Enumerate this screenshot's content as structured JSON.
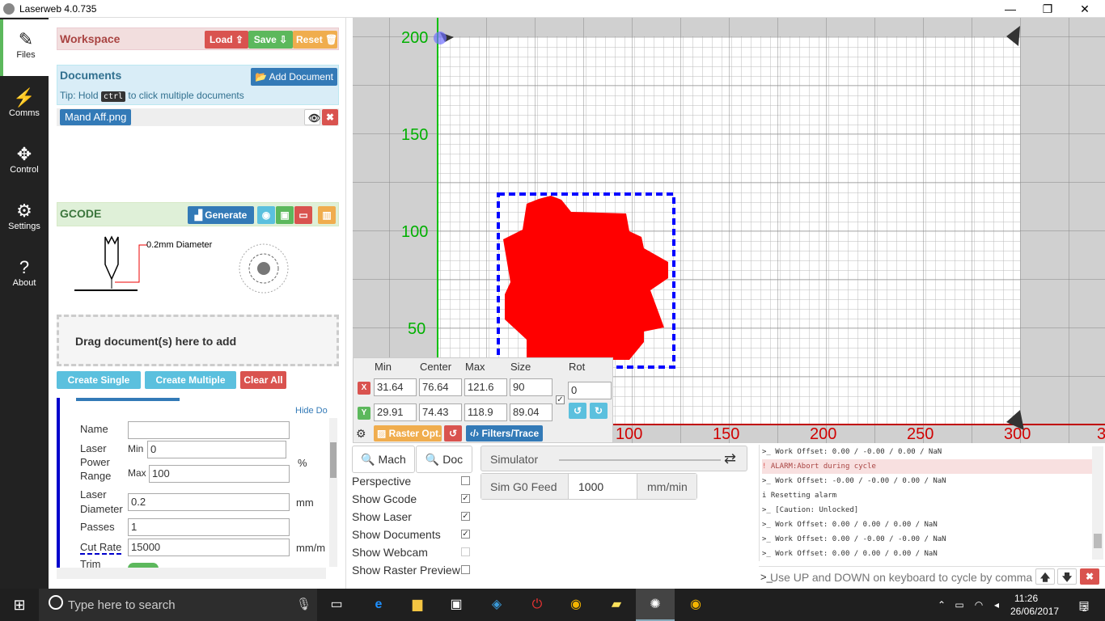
{
  "window": {
    "title": "Laserweb 4.0.735",
    "min": "—",
    "max": "❐",
    "close": "✕"
  },
  "nav": [
    {
      "label": "Files",
      "icon": "✎"
    },
    {
      "label": "Comms",
      "icon": "⚡"
    },
    {
      "label": "Control",
      "icon": "✥"
    },
    {
      "label": "Settings",
      "icon": "⚙"
    },
    {
      "label": "About",
      "icon": "?"
    }
  ],
  "workspace": {
    "title": "Workspace",
    "load": "Load ⇪",
    "save": "Save ⇩",
    "reset": "Reset 🗑"
  },
  "documents": {
    "title": "Documents",
    "add": "Add Document",
    "tip_pre": "Tip: Hold",
    "tip_key": "ctrl",
    "tip_post": "to click multiple documents",
    "file": "Mand Aff.png"
  },
  "gcode": {
    "title": "GCODE",
    "generate": "Generate",
    "diameter_label": "0.2mm Diameter"
  },
  "drop": {
    "text": "Drag document(s) here to add"
  },
  "ops": {
    "create_single": "Create Single",
    "create_multiple": "Create Multiple",
    "clear_all": "Clear All",
    "hide_docs": "Hide Do"
  },
  "form": {
    "name_label": "Name",
    "name_value": "",
    "power_label_1": "Laser",
    "power_label_2": "Power",
    "power_label_3": "Range",
    "min_label": "Min",
    "min_value": "0",
    "max_label": "Max",
    "max_value": "100",
    "percent": "%",
    "diam_label_1": "Laser",
    "diam_label_2": "Diameter",
    "diam_value": "0.2",
    "mm": "mm",
    "passes_label": "Passes",
    "passes_value": "1",
    "cutrate_label": "Cut Rate",
    "cutrate_value": "15000",
    "mmm": "mm/m",
    "trim_label": "Trim"
  },
  "axes": {
    "y_ticks": [
      "200",
      "150",
      "100",
      "50"
    ],
    "x_ticks": [
      "100",
      "150",
      "200",
      "250",
      "300",
      "3"
    ]
  },
  "transform": {
    "headers": [
      "Min",
      "Center",
      "Max",
      "Size",
      "Rot"
    ],
    "x_label": "X",
    "y_label": "Y",
    "x": {
      "min": "31.64",
      "center": "76.64",
      "max": "121.6",
      "size": "90"
    },
    "y": {
      "min": "29.91",
      "center": "74.43",
      "max": "118.9",
      "size": "89.04"
    },
    "rot": "0",
    "raster_opt": "Raster Opt.",
    "filters": "Filters/Trace"
  },
  "view": {
    "mach": "Mach",
    "doc": "Doc",
    "options": [
      {
        "label": "Perspective",
        "checked": false
      },
      {
        "label": "Show Gcode",
        "checked": true
      },
      {
        "label": "Show Laser",
        "checked": true
      },
      {
        "label": "Show Documents",
        "checked": true
      },
      {
        "label": "Show Webcam",
        "checked": false
      },
      {
        "label": "Show Raster Preview",
        "checked": false
      }
    ]
  },
  "sim": {
    "simulator": "Simulator",
    "g0_label": "Sim G0 Feed",
    "g0_value": "1000",
    "g0_unit": "mm/min"
  },
  "log": {
    "lines": [
      {
        "prefix": ">_",
        "text": "Work Offset: 0.00 / -0.00 / 0.00 / NaN",
        "type": "normal"
      },
      {
        "prefix": "!",
        "text": "ALARM:Abort during cycle",
        "type": "alarm"
      },
      {
        "prefix": ">_",
        "text": "Work Offset: -0.00 / -0.00 / 0.00 / NaN",
        "type": "normal"
      },
      {
        "prefix": "i",
        "text": "Resetting alarm",
        "type": "info"
      },
      {
        "prefix": ">_",
        "text": "[Caution: Unlocked]",
        "type": "normal"
      },
      {
        "prefix": ">_",
        "text": "Work Offset: 0.00 / 0.00 / 0.00 / NaN",
        "type": "normal"
      },
      {
        "prefix": ">_",
        "text": "Work Offset: 0.00 / -0.00 / -0.00 / NaN",
        "type": "normal"
      },
      {
        "prefix": ">_",
        "text": "Work Offset: 0.00 / 0.00 / 0.00 / NaN",
        "type": "normal"
      }
    ],
    "placeholder": "Use UP and DOWN on keyboard to cycle by comma",
    "prompt": ">_"
  },
  "taskbar": {
    "search": "Type here to search",
    "time": "11:26",
    "date": "26/06/2017",
    "notif": "2"
  },
  "colors": {
    "accent_green": "#5cb85c",
    "danger": "#d9534f",
    "warning": "#f0ad4e",
    "primary": "#337ab7",
    "info": "#5bc0de",
    "shape": "#ff0000",
    "selection": "#0000ff"
  }
}
